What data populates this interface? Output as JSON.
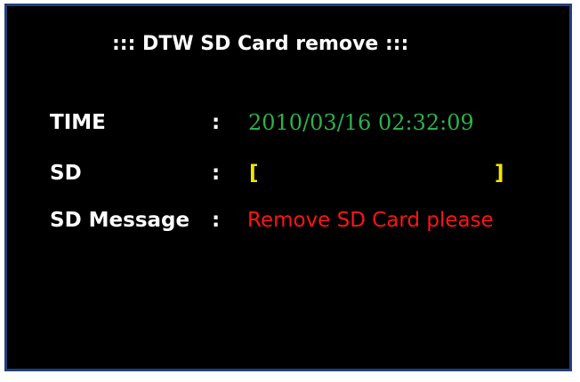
{
  "title": "::: DTW SD Card remove :::",
  "rows": {
    "time": {
      "label": "TIME",
      "separator": ":",
      "value": "2010/03/16 02:32:09"
    },
    "sd": {
      "label": "SD",
      "separator": ":",
      "bracket_open": "[",
      "bracket_close": "]",
      "progress": 0
    },
    "message": {
      "label": "SD Message",
      "separator": ":",
      "value": "Remove SD Card please"
    }
  },
  "colors": {
    "background": "#000000",
    "frame": "#213f7a",
    "label": "#ffffff",
    "time_value": "#2bb24c",
    "bracket": "#f2e600",
    "message_value": "#ff1414"
  }
}
